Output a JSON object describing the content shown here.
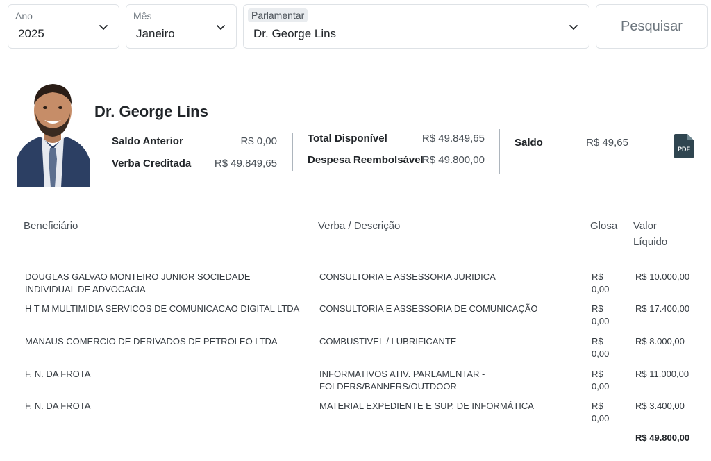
{
  "filters": {
    "ano": {
      "label": "Ano",
      "value": "2025"
    },
    "mes": {
      "label": "Mês",
      "value": "Janeiro"
    },
    "parlamentar": {
      "label": "Parlamentar",
      "value": "Dr. George Lins"
    },
    "search_label": "Pesquisar"
  },
  "profile": {
    "name": "Dr. George Lins",
    "summary": {
      "saldo_anterior": {
        "label": "Saldo Anterior",
        "value": "R$ 0,00"
      },
      "verba_creditada": {
        "label": "Verba Creditada",
        "value": "R$ 49.849,65"
      },
      "total_disponivel": {
        "label": "Total Disponível",
        "value": "R$ 49.849,65"
      },
      "despesa_reembolsavel": {
        "label": "Despesa Reembolsável",
        "value": "R$ 49.800,00"
      },
      "saldo": {
        "label": "Saldo",
        "value": "R$ 49,65"
      }
    },
    "pdf_icon": "pdf-file-icon"
  },
  "table": {
    "headers": {
      "beneficiario": "Beneficiário",
      "verba": "Verba / Descrição",
      "glosa": "Glosa",
      "valor_line1": "Valor",
      "valor_line2": "Líquido"
    },
    "rows": [
      {
        "beneficiario": "DOUGLAS GALVAO MONTEIRO JUNIOR SOCIEDADE INDIVIDUAL DE ADVOCACIA",
        "verba": "CONSULTORIA E ASSESSORIA JURIDICA",
        "glosa_1": "R$",
        "glosa_2": "0,00",
        "valor": "R$ 10.000,00"
      },
      {
        "beneficiario": "H T M MULTIMIDIA SERVICOS DE COMUNICACAO DIGITAL LTDA",
        "verba": "CONSULTORIA E ASSESSORIA DE COMUNICAÇÃO",
        "glosa_1": "R$",
        "glosa_2": "0,00",
        "valor": "R$ 17.400,00"
      },
      {
        "beneficiario": "MANAUS COMERCIO DE DERIVADOS DE PETROLEO LTDA",
        "verba": "COMBUSTIVEL / LUBRIFICANTE",
        "glosa_1": "R$",
        "glosa_2": "0,00",
        "valor": "R$ 8.000,00"
      },
      {
        "beneficiario": "F. N. DA FROTA",
        "verba": "INFORMATIVOS ATIV. PARLAMENTAR - FOLDERS/BANNERS/OUTDOOR",
        "glosa_1": "R$",
        "glosa_2": "0,00",
        "valor": "R$ 11.000,00"
      },
      {
        "beneficiario": "F. N. DA FROTA",
        "verba": "MATERIAL EXPEDIENTE E SUP. DE INFORMÁTICA",
        "glosa_1": "R$",
        "glosa_2": "0,00",
        "valor": "R$ 3.400,00"
      }
    ],
    "total": "R$ 49.800,00"
  },
  "colors": {
    "pdf_icon": "#2f4550",
    "border": "#dee2e6"
  }
}
